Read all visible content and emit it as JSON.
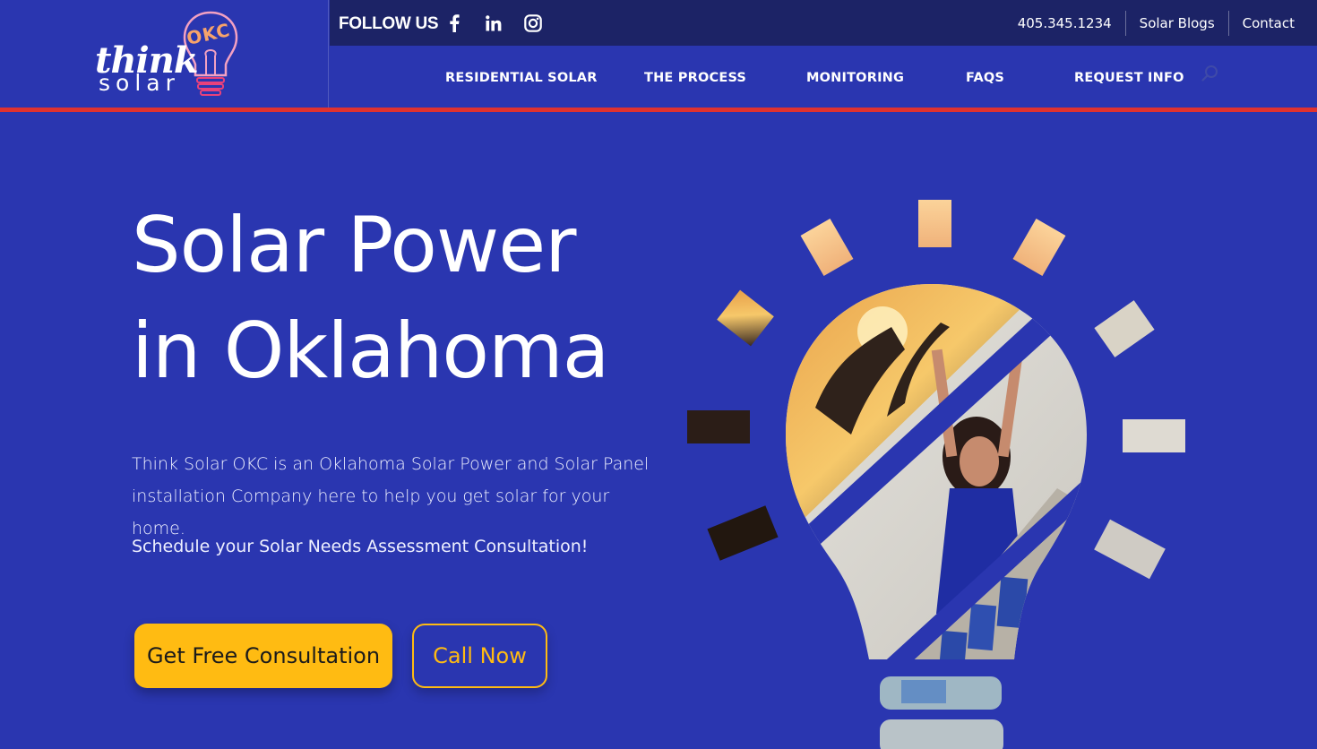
{
  "brand": {
    "logo_line1": "think",
    "logo_line2": "solar",
    "logo_badge": "OKC"
  },
  "topbar": {
    "follow_label": "FOLLOW US",
    "social": [
      "facebook-icon",
      "linkedin-icon",
      "instagram-icon"
    ],
    "links": [
      "405.345.1234",
      "Solar Blogs",
      "Contact"
    ]
  },
  "nav": {
    "items": [
      "RESIDENTIAL SOLAR",
      "THE PROCESS",
      "MONITORING",
      "FAQS",
      "REQUEST INFO"
    ],
    "search_icon": "search-icon"
  },
  "hero": {
    "title_line1": "Solar Power",
    "title_line2": "in Oklahoma",
    "description": "Think Solar OKC is an Oklahoma Solar Power and Solar Panel installation Company here to help you get solar for your home.",
    "subtext": "Schedule your Solar Needs Assessment Consultation!",
    "primary_button": "Get Free Consultation",
    "secondary_button": "Call Now"
  },
  "colors": {
    "background": "#2a36b0",
    "topbar": "#1c2366",
    "accent_red": "#e0322f",
    "accent_yellow": "#ffbb12"
  }
}
